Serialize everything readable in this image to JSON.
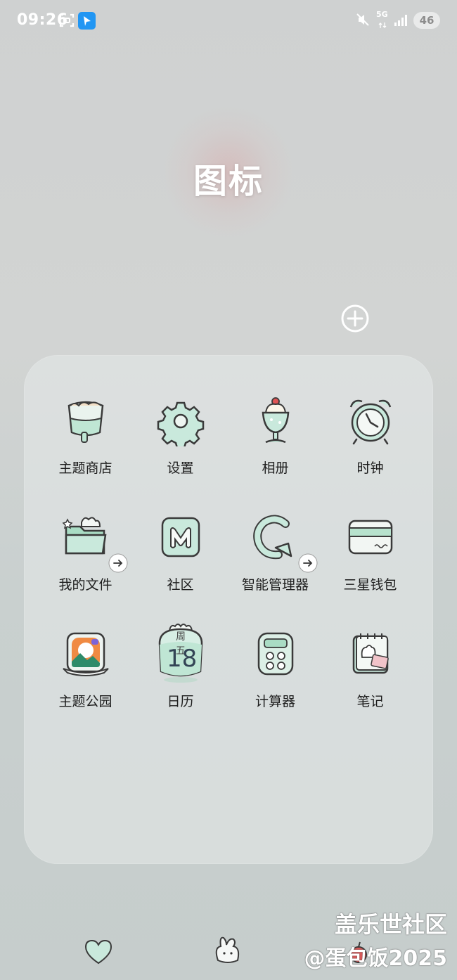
{
  "status_bar": {
    "time": "09:26",
    "network_label": "5G",
    "battery": "46"
  },
  "folder": {
    "title": "图标"
  },
  "apps": [
    {
      "label": "主题商店",
      "icon": "paint-bucket-icon"
    },
    {
      "label": "设置",
      "icon": "gear-icon"
    },
    {
      "label": "相册",
      "icon": "sundae-cup-icon"
    },
    {
      "label": "时钟",
      "icon": "alarm-clock-icon"
    },
    {
      "label": "我的文件",
      "icon": "folder-icon"
    },
    {
      "label": "社区",
      "icon": "m-tile-icon"
    },
    {
      "label": "智能管理器",
      "icon": "refresh-g-icon"
    },
    {
      "label": "三星钱包",
      "icon": "wallet-card-icon"
    },
    {
      "label": "主题公园",
      "icon": "theme-park-icon"
    },
    {
      "label": "日历",
      "icon": "calendar-icon"
    },
    {
      "label": "计算器",
      "icon": "calculator-icon"
    },
    {
      "label": "笔记",
      "icon": "notebook-icon"
    }
  ],
  "calendar_icon": {
    "weekday": "周五",
    "day": "18"
  },
  "watermark": {
    "line1": "盖乐世社区",
    "line2": "@蛋包饭2025"
  },
  "colors": {
    "mint": "#c9e9dc",
    "mint_dark": "#9fd1bc",
    "outline": "#3a3a3a",
    "folder_bg": "#e3e7e6"
  }
}
